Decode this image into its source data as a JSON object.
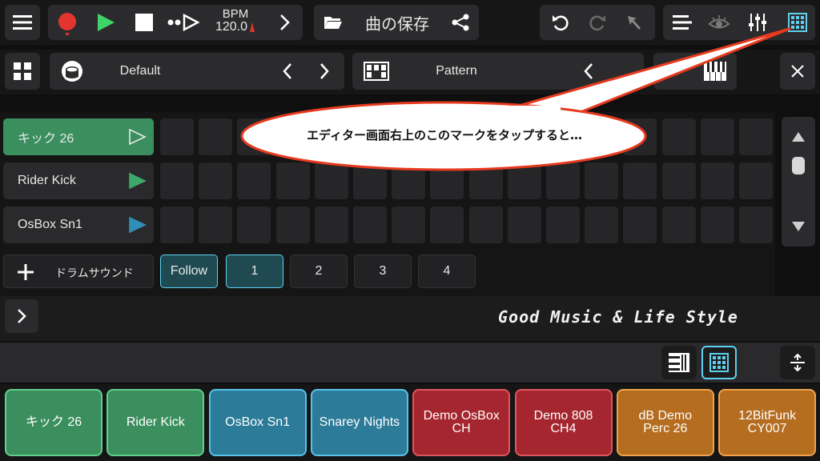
{
  "toolbar": {
    "bpm_label": "BPM",
    "bpm_value": "120.0",
    "song_save_label": "曲の保存",
    "icons": [
      "menu-icon",
      "record-icon",
      "play-icon",
      "stop-icon",
      "step-play-icon",
      "chevron-right-icon",
      "folder-icon",
      "share-icon",
      "undo-icon",
      "redo-icon",
      "pointer-icon",
      "list-icon",
      "eye-icon",
      "mixer-icon",
      "grid-icon"
    ]
  },
  "editor_bar": {
    "kit_name": "Default",
    "pattern_name": "Pattern",
    "icons": [
      "grid-view-icon",
      "drum-icon",
      "chevron-left-icon",
      "chevron-right-icon",
      "pattern-icon",
      "keyboard-icon",
      "close-icon"
    ]
  },
  "tracks": [
    {
      "label": "キック 26",
      "color": "#3b8f5e",
      "play_color": "outline"
    },
    {
      "label": "Rider Kick",
      "color": "#2a2a2c",
      "play_color": "#3ea76a"
    },
    {
      "label": "OsBox Sn1",
      "color": "#2a2a2c",
      "play_color": "#2f8fb5"
    }
  ],
  "add_sound_label": "ドラムサウンド",
  "follow_label": "Follow",
  "pages": [
    "1",
    "2",
    "3",
    "4"
  ],
  "callout_text": "エディター画面右上のこのマークをタップすると…",
  "slogan": "Good Music & Life Style",
  "pads": [
    {
      "label": "キック 26",
      "color": "green"
    },
    {
      "label": "Rider Kick",
      "color": "green"
    },
    {
      "label": "OsBox Sn1",
      "color": "blue"
    },
    {
      "label": "Snarey Nights",
      "color": "blue"
    },
    {
      "label": "Demo OsBox\nCH",
      "color": "red"
    },
    {
      "label": "Demo 808\nCH4",
      "color": "red"
    },
    {
      "label": "dB Demo\nPerc 26",
      "color": "orange"
    },
    {
      "label": "12BitFunk\nCY007",
      "color": "orange"
    }
  ],
  "accent": {
    "cyan": "#5fd0f0",
    "green": "#3ea76a",
    "red": "#e3342f"
  }
}
